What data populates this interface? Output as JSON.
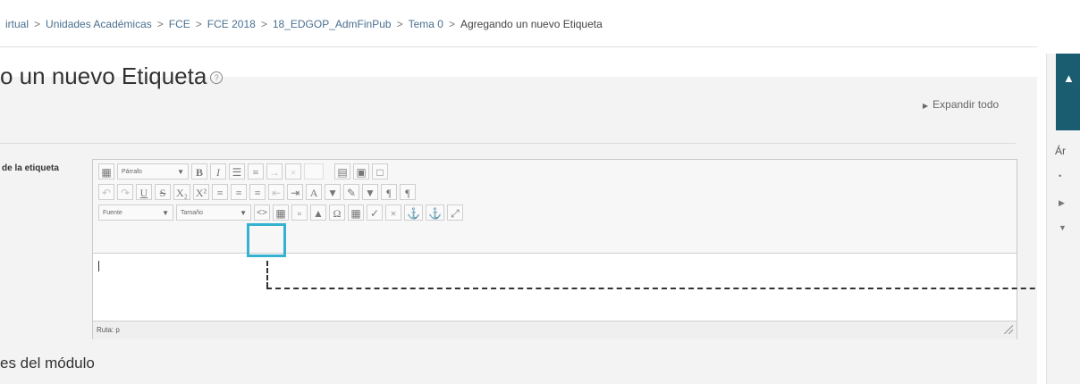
{
  "breadcrumb": [
    {
      "label": "irtual"
    },
    {
      "label": "Unidades Académicas"
    },
    {
      "label": "FCE"
    },
    {
      "label": "FCE 2018"
    },
    {
      "label": "18_EDGOP_AdmFinPub"
    },
    {
      "label": "Tema 0"
    },
    {
      "label": "Agregando un nuevo Etiqueta"
    }
  ],
  "breadcrumb_separator": ">",
  "page": {
    "title": "o un nuevo Etiqueta",
    "help_glyph": "?",
    "expand_all": "Expandir todo"
  },
  "form": {
    "field_label": "de la etiqueta",
    "section_heading": "es del módulo"
  },
  "editor": {
    "paragraph_select": "Párrafo",
    "font_select": "Fuente",
    "size_select": "Tamaño",
    "path_label": "Ruta: p",
    "row1_buttons": [
      "B",
      "I",
      "☰",
      "≡"
    ],
    "row2_buttons": [
      "U",
      "S",
      "X₂",
      "X²",
      "A",
      "¶",
      "¶"
    ],
    "html_button_glyph": "<>",
    "omega": "Ω"
  },
  "right_panel": {
    "heading_partial": "Ár"
  },
  "colors": {
    "highlight": "#35b1d1",
    "block_header": "#1a5c70",
    "link": "#4a6f8f"
  }
}
